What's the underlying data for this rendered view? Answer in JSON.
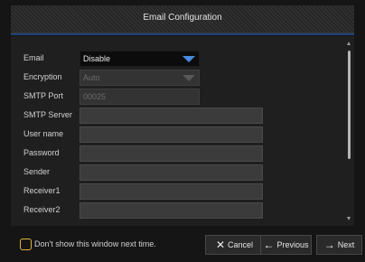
{
  "window": {
    "title": "Email Configuration"
  },
  "form": {
    "email": {
      "label": "Email",
      "value": "Disable"
    },
    "encryption": {
      "label": "Encryption",
      "value": "Auto"
    },
    "smtp_port": {
      "label": "SMTP Port",
      "value": "00025"
    },
    "smtp_server": {
      "label": "SMTP Server",
      "value": ""
    },
    "user_name": {
      "label": "User name",
      "value": ""
    },
    "password": {
      "label": "Password",
      "value": ""
    },
    "sender": {
      "label": "Sender",
      "value": ""
    },
    "receiver1": {
      "label": "Receiver1",
      "value": ""
    },
    "receiver2": {
      "label": "Receiver2",
      "value": ""
    }
  },
  "footer": {
    "checkbox_label": "Don't show this window next time.",
    "cancel_label": "Cancel",
    "cancel_icon": "close-icon",
    "previous_label": "Previous",
    "previous_icon": "arrow-left-icon",
    "next_label": "Next",
    "next_icon": "arrow-right-icon"
  },
  "colors": {
    "accent": "#1e3f7c",
    "dropdown_arrow": "#4a8be0",
    "checkbox_border": "#e0b33a"
  }
}
